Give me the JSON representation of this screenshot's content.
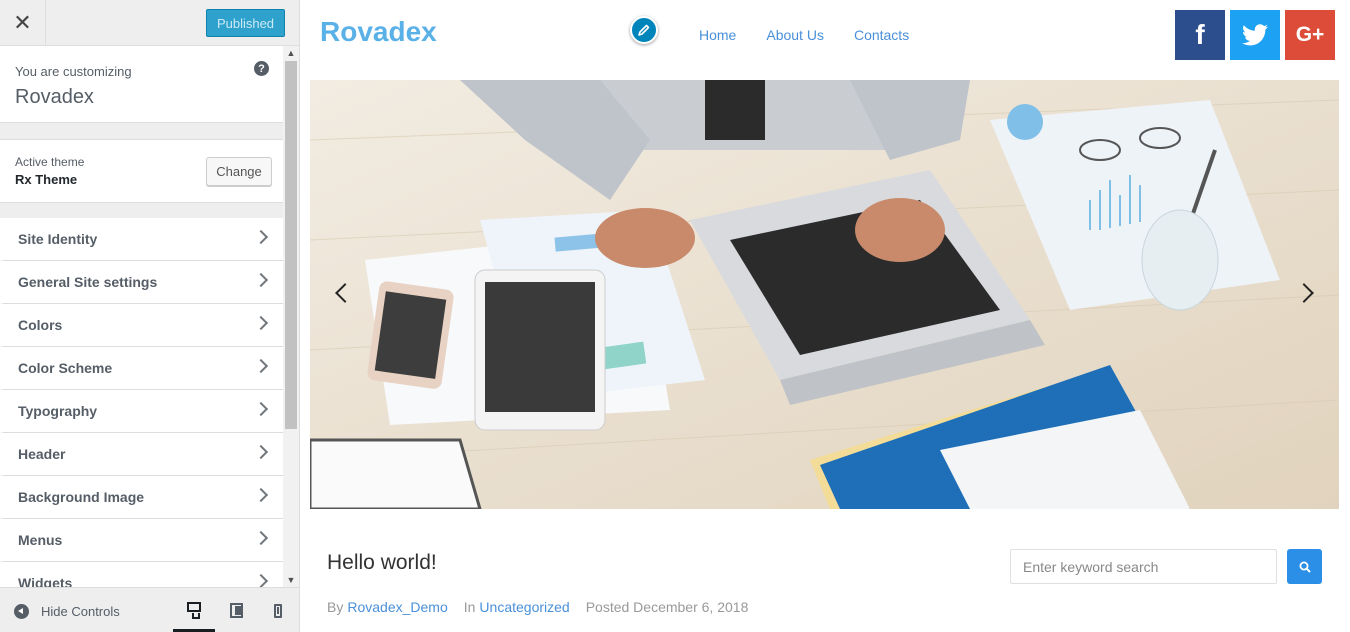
{
  "sidebar": {
    "close_icon": "close-icon",
    "publish_label": "Published",
    "info": {
      "label": "You are customizing",
      "site_name": "Rovadex"
    },
    "theme": {
      "label": "Active theme",
      "name": "Rx Theme",
      "change_label": "Change"
    },
    "items": [
      {
        "label": "Site Identity"
      },
      {
        "label": "General Site settings"
      },
      {
        "label": "Colors"
      },
      {
        "label": "Color Scheme"
      },
      {
        "label": "Typography"
      },
      {
        "label": "Header"
      },
      {
        "label": "Background Image"
      },
      {
        "label": "Menus"
      },
      {
        "label": "Widgets"
      }
    ],
    "footer": {
      "hide_label": "Hide Controls",
      "active_device": "desktop"
    },
    "colors": {
      "publish": "#2ea2cc",
      "panel_bg": "#eeeeee"
    }
  },
  "preview": {
    "brand": "Rovadex",
    "nav": [
      "Home",
      "About Us",
      "Contacts"
    ],
    "social": {
      "facebook": "f",
      "google": "G+"
    },
    "post": {
      "title": "Hello world!",
      "by_label": "By",
      "author": "Rovadex_Demo",
      "in_label": "In",
      "category": "Uncategorized",
      "posted": "Posted December 6, 2018"
    },
    "search": {
      "placeholder": "Enter keyword search"
    },
    "colors": {
      "brand": "#5ab1e8",
      "link": "#4a90d9",
      "facebook": "#2d4e8c",
      "twitter": "#1da1f2",
      "google": "#dd4b39",
      "search_btn": "#2b8fe8"
    }
  }
}
